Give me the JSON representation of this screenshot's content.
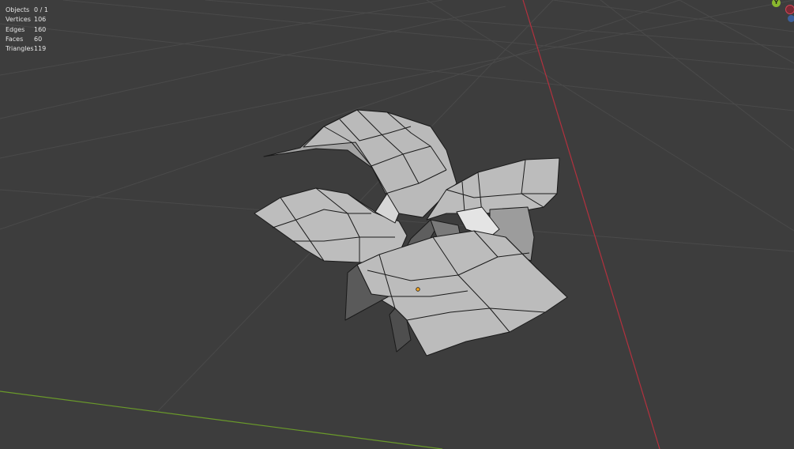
{
  "stats": {
    "objects_label": "Objects",
    "objects_value": "0 / 1",
    "vertices_label": "Vertices",
    "vertices_value": "106",
    "edges_label": "Edges",
    "edges_value": "160",
    "faces_label": "Faces",
    "faces_value": "60",
    "triangles_label": "Triangles",
    "triangles_value": "119"
  },
  "gizmo": {
    "y_label": "Y"
  },
  "colors": {
    "background": "#3d3d3d",
    "grid_line": "#4a4a4a",
    "x_axis": "#b3313e",
    "y_axis": "#6a9a2a",
    "mesh_face": "#b8b8b8",
    "mesh_edge": "#1a1a1a",
    "origin_point": "#f5a623"
  }
}
